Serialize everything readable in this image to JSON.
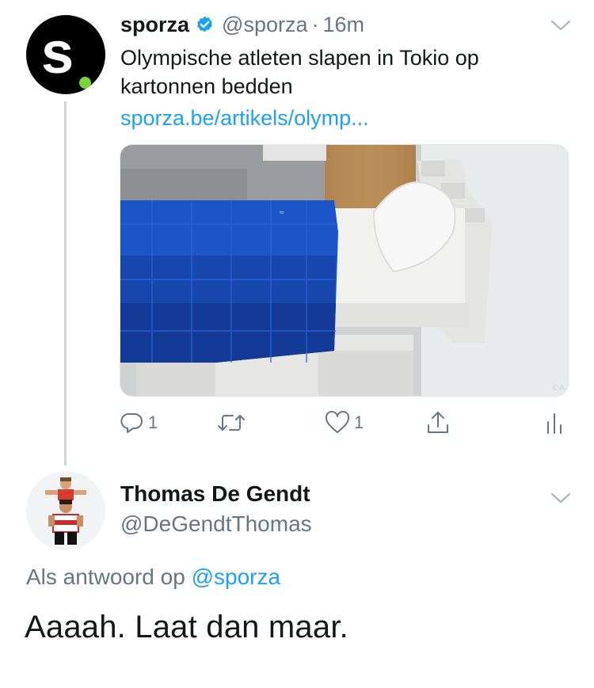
{
  "tweet": {
    "author_name": "sporza",
    "handle": "@sporza",
    "separator": "·",
    "time": "16m",
    "avatar_letter": "s",
    "text": "Olympische atleten slapen in Tokio op kartonnen bedden",
    "link": "sporza.be/artikels/olymp...",
    "media_credit": "©A",
    "icons": {
      "verified": "verified-badge-icon",
      "menu": "chevron-down-icon",
      "reply": "reply-icon",
      "retweet": "retweet-icon",
      "like": "heart-icon",
      "share": "share-icon",
      "analytics": "analytics-icon"
    },
    "actions": {
      "reply_count": "1",
      "like_count": "1"
    }
  },
  "reply": {
    "author_name": "Thomas De Gendt",
    "handle": "@DeGendtThomas",
    "reply_prefix": "Als antwoord op",
    "reply_mention": "@sporza",
    "text": "Aaaah. Laat dan maar."
  },
  "colors": {
    "accent": "#1da1f2",
    "muted": "#657786",
    "text": "#14171a",
    "sporza_green": "#7bd23a"
  }
}
